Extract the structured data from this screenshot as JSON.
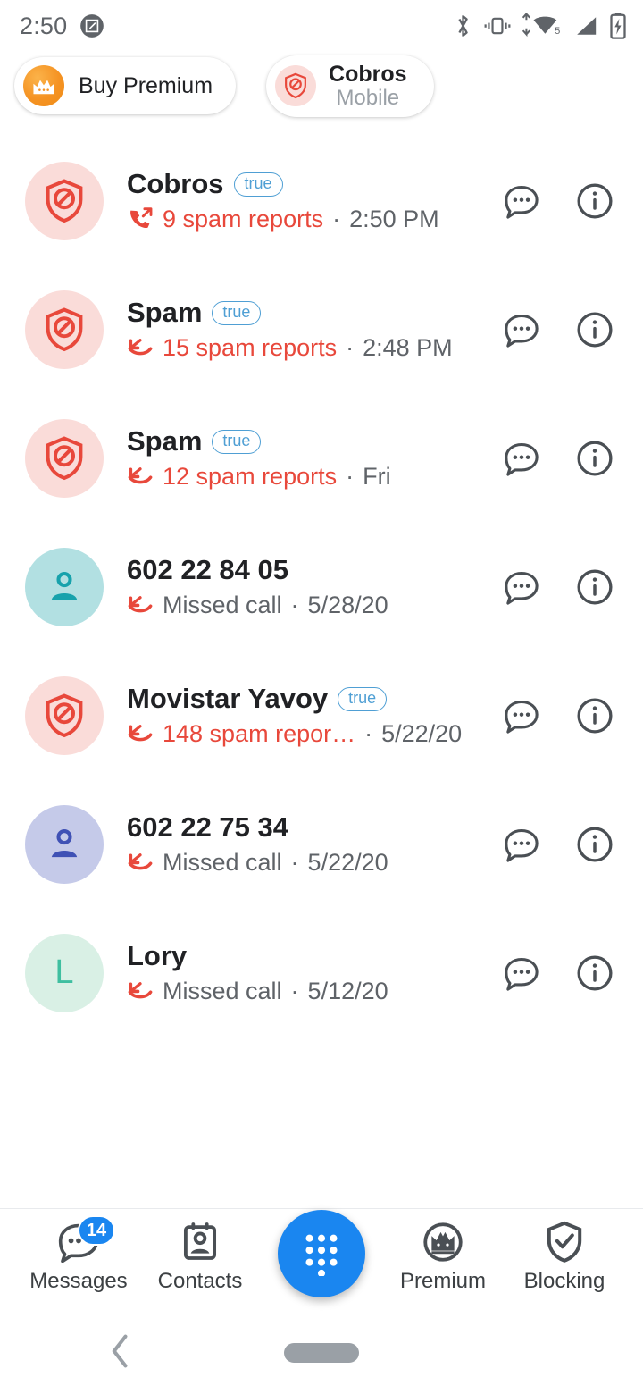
{
  "status_bar": {
    "time": "2:50",
    "icons": [
      "screenshot-notification-icon",
      "bluetooth-icon",
      "vibrate-icon",
      "wifi-icon",
      "cellular-signal-icon",
      "battery-charging-icon"
    ],
    "wifi_level": "5"
  },
  "header": {
    "premium_chip": {
      "label": "Buy Premium",
      "icon": "crown-icon",
      "accent": "#f59323"
    },
    "account_chip": {
      "name": "Cobros",
      "subtitle": "Mobile",
      "icon": "shield-block-icon",
      "accent": "#e8483b"
    }
  },
  "call_list": [
    {
      "name": "Cobros",
      "verified_badge": "true",
      "avatar_type": "shield-block",
      "avatar_bg": "#fadcd9",
      "avatar_fg": "#e8483b",
      "avatar_letter": "",
      "call_type_icon": "outgoing-call-icon",
      "detail": "9 spam reports",
      "detail_is_spam": true,
      "separator": "·",
      "time": "2:50 PM"
    },
    {
      "name": "Spam",
      "verified_badge": "true",
      "avatar_type": "shield-block",
      "avatar_bg": "#fadcd9",
      "avatar_fg": "#e8483b",
      "avatar_letter": "",
      "call_type_icon": "missed-call-icon",
      "detail": "15 spam reports",
      "detail_is_spam": true,
      "separator": "·",
      "time": "2:48 PM"
    },
    {
      "name": "Spam",
      "verified_badge": "true",
      "avatar_type": "shield-block",
      "avatar_bg": "#fadcd9",
      "avatar_fg": "#e8483b",
      "avatar_letter": "",
      "call_type_icon": "missed-call-icon",
      "detail": "12 spam reports",
      "detail_is_spam": true,
      "separator": "·",
      "time": "Fri"
    },
    {
      "name": "602 22 84 05",
      "verified_badge": "",
      "avatar_type": "person",
      "avatar_bg": "#b2e0e2",
      "avatar_fg": "#17a2ac",
      "avatar_letter": "",
      "call_type_icon": "missed-call-icon",
      "detail": "Missed call",
      "detail_is_spam": false,
      "separator": "·",
      "time": "5/28/20"
    },
    {
      "name": "Movistar Yavoy",
      "verified_badge": "true",
      "avatar_type": "shield-block",
      "avatar_bg": "#fadcd9",
      "avatar_fg": "#e8483b",
      "avatar_letter": "",
      "call_type_icon": "missed-call-icon",
      "detail": "148 spam repor…",
      "detail_is_spam": true,
      "separator": "·",
      "time": "5/22/20"
    },
    {
      "name": "602 22 75 34",
      "verified_badge": "",
      "avatar_type": "person",
      "avatar_bg": "#c5cae9",
      "avatar_fg": "#3f51b5",
      "avatar_letter": "",
      "call_type_icon": "missed-call-icon",
      "detail": "Missed call",
      "detail_is_spam": false,
      "separator": "·",
      "time": "5/22/20"
    },
    {
      "name": "Lory",
      "verified_badge": "",
      "avatar_type": "letter",
      "avatar_bg": "#d9f0e5",
      "avatar_fg": "#3fbfa0",
      "avatar_letter": "L",
      "call_type_icon": "missed-call-icon",
      "detail": "Missed call",
      "detail_is_spam": false,
      "separator": "·",
      "time": "5/12/20"
    }
  ],
  "row_actions": {
    "message_icon": "message-bubble-icon",
    "info_icon": "info-circle-icon"
  },
  "bottom_nav": {
    "items": [
      {
        "label": "Messages",
        "icon": "message-bubble-icon",
        "badge": "14"
      },
      {
        "label": "Contacts",
        "icon": "contact-card-icon",
        "badge": ""
      },
      {
        "label": "Premium",
        "icon": "crown-circle-icon",
        "badge": ""
      },
      {
        "label": "Blocking",
        "icon": "shield-check-icon",
        "badge": ""
      }
    ],
    "fab": {
      "icon": "dialpad-icon",
      "color": "#1a86f0"
    },
    "badge_color": "#1a86f0"
  },
  "system_nav": {
    "back_icon": "chevron-left-icon",
    "home_icon": "home-pill-icon"
  }
}
